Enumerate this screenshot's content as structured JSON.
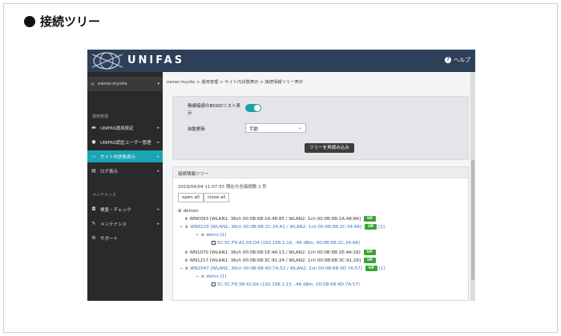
{
  "heading": {
    "title": "接続ツリー"
  },
  "app": {
    "brand": "UNIFAS",
    "help_label": "ヘルプ"
  },
  "sidebar": {
    "site_name": "owner.mysite",
    "section_admin": "運用管理",
    "items": [
      {
        "label": "UNIFAS運用設定",
        "icon": "monitor-icon"
      },
      {
        "label": "UNIFAS認証ユーザー管理",
        "icon": "users-icon"
      },
      {
        "label": "サイト内状態表示",
        "icon": "display-icon",
        "active": true
      },
      {
        "label": "ログ表示",
        "icon": "log-icon"
      }
    ],
    "section_maint": "メンテナンス",
    "maint_items": [
      {
        "label": "検査・チェック",
        "icon": "check-icon"
      },
      {
        "label": "メンテナンス",
        "icon": "wrench-icon"
      },
      {
        "label": "サポート",
        "icon": "support-icon"
      }
    ]
  },
  "breadcrumb": "owner.mysite > 運用管理 > サイト内状態表示 > 接続情報ツリー表示",
  "settings": {
    "bssid_label": "無線接続のBSSIDリスト表示",
    "bssid_enabled": true,
    "auto_update_label": "自動更新",
    "auto_update_value": "手動",
    "reload_button": "ツリーを再読み込み"
  },
  "tree_panel": {
    "title": "接続情報ツリー",
    "count_text": "2019/04/04 11:07:55 現在の全接続数 2 件",
    "open_all": "open all",
    "close_all": "close all",
    "root": "demon",
    "rows": [
      {
        "text": "WN0093 [WLAN1: 36ch 00:0B:6B:1A:48:85 / WLAN2: 1ch 00:0B:6B:1A:48:8A]",
        "badge": "UP",
        "count": ""
      },
      {
        "text": "WN0229 [WLAN1: 36ch 00:0B:6B:2C:34:A1 / WLAN2: 1ch 00:0B:6B:2C:34:A6]",
        "badge": "UP",
        "count": "[1]"
      },
      {
        "text": "demo [1]",
        "badge": "",
        "count": ""
      },
      {
        "text": "5C:5C:F9:A1:09:D4 (192.168.1.16, -46 dBm, 00:0B:6B:2C:34:A6)",
        "badge": "",
        "count": ""
      },
      {
        "text": "WN1070 [WLAN1: 36ch 00:0B:6B:1E:4A:13 / WLAN2: 1ch 00:0B:6B:1E:4A:18]",
        "badge": "UP",
        "count": ""
      },
      {
        "text": "WN1217 [WLAN1: 36ch 00:0B:6B:3C:91:24 / WLAN2: 1ch 00:0B:6B:3C:91:29]",
        "badge": "UP",
        "count": ""
      },
      {
        "text": "WN2047 [WLAN1: 36ch 00:0B:6B:4D:7A:52 / WLAN2: 1ch 00:0B:6B:4D:7A:57]",
        "badge": "UP",
        "count": "[1]"
      },
      {
        "text": "demo [1]",
        "badge": "",
        "count": ""
      },
      {
        "text": "5C:5C:F9:3B:42:6A (192.168.1.15, -46 dBm, 00:0B:6B:4D:7A:57)",
        "badge": "",
        "count": ""
      }
    ]
  }
}
